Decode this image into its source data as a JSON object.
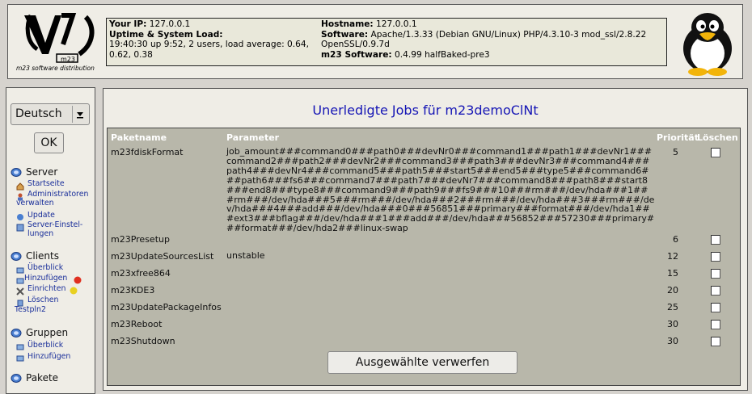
{
  "header": {
    "logo_caption": "m23 software distribution",
    "info": {
      "ip_label": "Your IP:",
      "ip_value": "127.0.0.1",
      "uptime_label": "Uptime & System Load:",
      "uptime_value": "19:40:30 up 9:52, 2 users, load average: 0.64, 0.62, 0.38",
      "hostname_label": "Hostname:",
      "hostname_value": "127.0.0.1",
      "software_label": "Software:",
      "software_value": "Apache/1.3.33 (Debian GNU/Linux) PHP/4.3.10-3 mod_ssl/2.8.22 OpenSSL/0.9.7d",
      "m23_label": "m23 Software:",
      "m23_value": "0.4.99 halfBaked-pre3"
    }
  },
  "sidebar": {
    "language_selected": "Deutsch",
    "ok_label": "OK",
    "server": {
      "title": "Server",
      "items": [
        {
          "label": "Startseite"
        },
        {
          "label": "Administratoren"
        },
        {
          "label": "verwalten"
        },
        {
          "label": "Update"
        },
        {
          "label": "Server-Einstel-"
        },
        {
          "label": "lungen"
        }
      ]
    },
    "clients": {
      "title": "Clients",
      "items": [
        {
          "label": "Überblick"
        },
        {
          "label": "Hinzufügen"
        },
        {
          "label": "Einrichten"
        },
        {
          "label": "Löschen"
        },
        {
          "label": "Testpln2"
        }
      ]
    },
    "groups": {
      "title": "Gruppen",
      "items": [
        {
          "label": "Überblick"
        },
        {
          "label": "Hinzufügen"
        }
      ]
    },
    "packages": {
      "title": "Pakete"
    }
  },
  "main": {
    "title": "Unerledigte Jobs für m23demoClNt",
    "columns": {
      "name": "Paketname",
      "param": "Parameter",
      "priority": "Priorität",
      "delete": "Löschen"
    },
    "rows": [
      {
        "name": "m23fdiskFormat",
        "param": "job_amount###command0###path0###devNr0###command1###path1###devNr1###command2###path2###devNr2###command3###path3###devNr3###command4###path4###devNr4###command5###path5###start5###end5###type5###command6###path6###fs6###command7###path7###devNr7###command8###path8###start8###end8###type8###command9###path9###fs9###10###rm###/dev/hda###1###rm###/dev/hda###5###rm###/dev/hda###2###rm###/dev/hda###3###rm###/dev/hda###4###add###/dev/hda###0###56851###primary###format###/dev/hda1###ext3###bflag###/dev/hda###1###add###/dev/hda###56852###57230###primary###format###/dev/hda2###linux-swap",
        "priority": "5"
      },
      {
        "name": "m23Presetup",
        "param": "",
        "priority": "6"
      },
      {
        "name": "m23UpdateSourcesList",
        "param": "unstable",
        "priority": "12"
      },
      {
        "name": "m23xfree864",
        "param": "",
        "priority": "15"
      },
      {
        "name": "m23KDE3",
        "param": "",
        "priority": "20"
      },
      {
        "name": "m23UpdatePackageInfos",
        "param": "",
        "priority": "25"
      },
      {
        "name": "m23Reboot",
        "param": "",
        "priority": "30"
      },
      {
        "name": "m23Shutdown",
        "param": "",
        "priority": "30"
      }
    ],
    "discard_button": "Ausgewählte verwerfen"
  }
}
